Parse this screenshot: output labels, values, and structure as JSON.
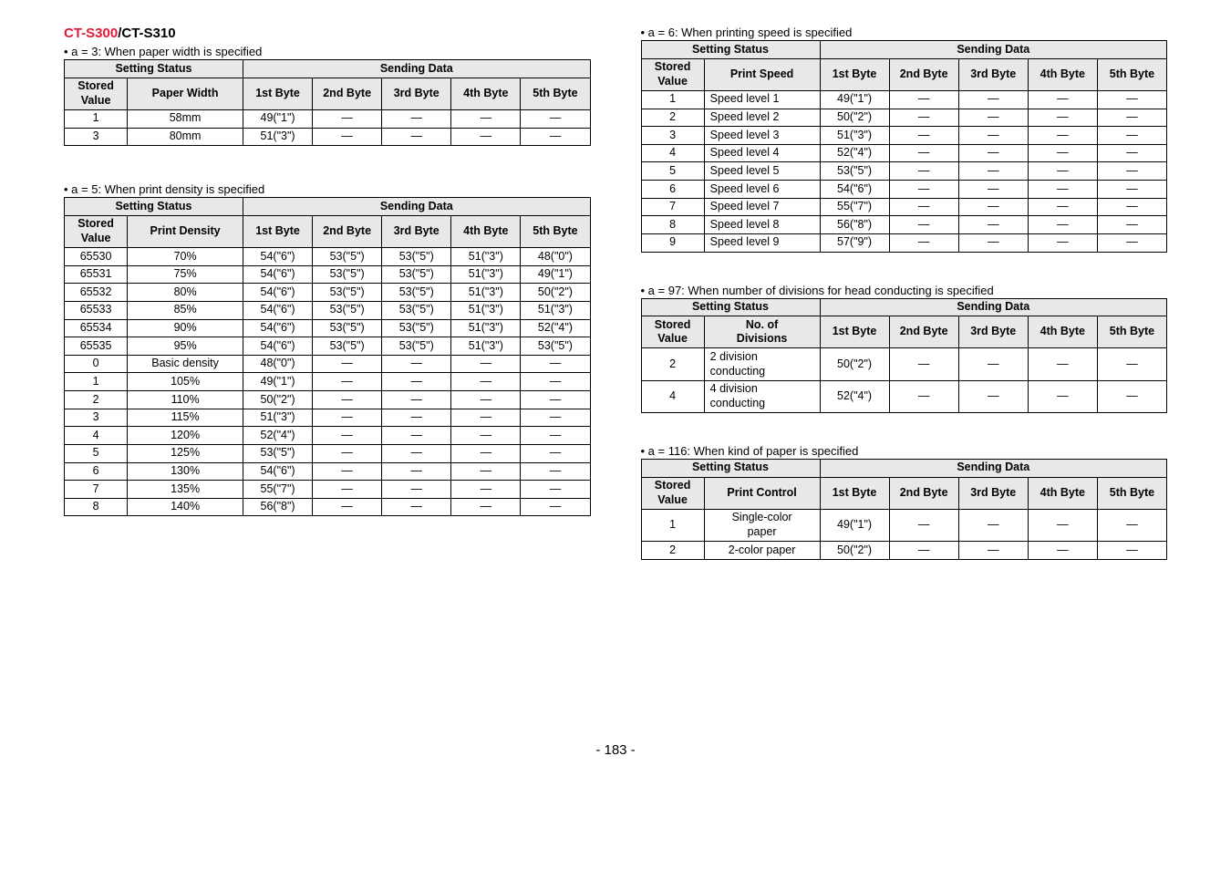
{
  "header": {
    "model_red": "CT-S300",
    "model_sep": "/",
    "model_black": "CT-S310"
  },
  "captions": {
    "a3": "• a = 3: When paper width is specified",
    "a5": "• a = 5: When print density is specified",
    "a6": "• a = 6: When printing speed is specified",
    "a97": "• a = 97: When number of divisions for head conducting is specified",
    "a116": "• a = 116: When kind of paper is specified"
  },
  "headers": {
    "setting_status": "Setting Status",
    "sending_data": "Sending Data",
    "stored_value": "Stored\nValue",
    "b1": "1st Byte",
    "b2": "2nd Byte",
    "b3": "3rd Byte",
    "b4": "4th Byte",
    "b5": "5th Byte"
  },
  "a3": {
    "param": "Paper Width",
    "rows": [
      {
        "sv": "1",
        "p": "58mm",
        "c": [
          "49(\"1\")",
          "—",
          "—",
          "—",
          "—"
        ]
      },
      {
        "sv": "3",
        "p": "80mm",
        "c": [
          "51(\"3\")",
          "—",
          "—",
          "—",
          "—"
        ]
      }
    ]
  },
  "a5": {
    "param": "Print Density",
    "rows": [
      {
        "sv": "65530",
        "p": "70%",
        "c": [
          "54(\"6\")",
          "53(\"5\")",
          "53(\"5\")",
          "51(\"3\")",
          "48(\"0\")"
        ]
      },
      {
        "sv": "65531",
        "p": "75%",
        "c": [
          "54(\"6\")",
          "53(\"5\")",
          "53(\"5\")",
          "51(\"3\")",
          "49(\"1\")"
        ]
      },
      {
        "sv": "65532",
        "p": "80%",
        "c": [
          "54(\"6\")",
          "53(\"5\")",
          "53(\"5\")",
          "51(\"3\")",
          "50(\"2\")"
        ]
      },
      {
        "sv": "65533",
        "p": "85%",
        "c": [
          "54(\"6\")",
          "53(\"5\")",
          "53(\"5\")",
          "51(\"3\")",
          "51(\"3\")"
        ]
      },
      {
        "sv": "65534",
        "p": "90%",
        "c": [
          "54(\"6\")",
          "53(\"5\")",
          "53(\"5\")",
          "51(\"3\")",
          "52(\"4\")"
        ]
      },
      {
        "sv": "65535",
        "p": "95%",
        "c": [
          "54(\"6\")",
          "53(\"5\")",
          "53(\"5\")",
          "51(\"3\")",
          "53(\"5\")"
        ]
      },
      {
        "sv": "0",
        "p": "Basic density",
        "c": [
          "48(\"0\")",
          "—",
          "—",
          "—",
          "—"
        ]
      },
      {
        "sv": "1",
        "p": "105%",
        "c": [
          "49(\"1\")",
          "—",
          "—",
          "—",
          "—"
        ]
      },
      {
        "sv": "2",
        "p": "110%",
        "c": [
          "50(\"2\")",
          "—",
          "—",
          "—",
          "—"
        ]
      },
      {
        "sv": "3",
        "p": "115%",
        "c": [
          "51(\"3\")",
          "—",
          "—",
          "—",
          "—"
        ]
      },
      {
        "sv": "4",
        "p": "120%",
        "c": [
          "52(\"4\")",
          "—",
          "—",
          "—",
          "—"
        ]
      },
      {
        "sv": "5",
        "p": "125%",
        "c": [
          "53(\"5\")",
          "—",
          "—",
          "—",
          "—"
        ]
      },
      {
        "sv": "6",
        "p": "130%",
        "c": [
          "54(\"6\")",
          "—",
          "—",
          "—",
          "—"
        ]
      },
      {
        "sv": "7",
        "p": "135%",
        "c": [
          "55(\"7\")",
          "—",
          "—",
          "—",
          "—"
        ]
      },
      {
        "sv": "8",
        "p": "140%",
        "c": [
          "56(\"8\")",
          "—",
          "—",
          "—",
          "—"
        ]
      }
    ]
  },
  "a6": {
    "param": "Print Speed",
    "rows": [
      {
        "sv": "1",
        "p": "Speed level 1",
        "c": [
          "49(\"1\")",
          "—",
          "—",
          "—",
          "—"
        ]
      },
      {
        "sv": "2",
        "p": "Speed level 2",
        "c": [
          "50(\"2\")",
          "—",
          "—",
          "—",
          "—"
        ]
      },
      {
        "sv": "3",
        "p": "Speed level 3",
        "c": [
          "51(\"3\")",
          "—",
          "—",
          "—",
          "—"
        ]
      },
      {
        "sv": "4",
        "p": "Speed level 4",
        "c": [
          "52(\"4\")",
          "—",
          "—",
          "—",
          "—"
        ]
      },
      {
        "sv": "5",
        "p": "Speed level 5",
        "c": [
          "53(\"5\")",
          "—",
          "—",
          "—",
          "—"
        ]
      },
      {
        "sv": "6",
        "p": "Speed level 6",
        "c": [
          "54(\"6\")",
          "—",
          "—",
          "—",
          "—"
        ]
      },
      {
        "sv": "7",
        "p": "Speed level 7",
        "c": [
          "55(\"7\")",
          "—",
          "—",
          "—",
          "—"
        ]
      },
      {
        "sv": "8",
        "p": "Speed level 8",
        "c": [
          "56(\"8\")",
          "—",
          "—",
          "—",
          "—"
        ]
      },
      {
        "sv": "9",
        "p": "Speed level 9",
        "c": [
          "57(\"9\")",
          "—",
          "—",
          "—",
          "—"
        ]
      }
    ]
  },
  "a97": {
    "param": "No. of\nDivisions",
    "rows": [
      {
        "sv": "2",
        "p": "2 division\nconducting",
        "c": [
          "50(\"2\")",
          "—",
          "—",
          "—",
          "—"
        ]
      },
      {
        "sv": "4",
        "p": "4 division\nconducting",
        "c": [
          "52(\"4\")",
          "—",
          "—",
          "—",
          "—"
        ]
      }
    ]
  },
  "a116": {
    "param": "Print Control",
    "rows": [
      {
        "sv": "1",
        "p": "Single-color\npaper",
        "c": [
          "49(\"1\")",
          "—",
          "—",
          "—",
          "—"
        ]
      },
      {
        "sv": "2",
        "p": "2-color paper",
        "c": [
          "50(\"2\")",
          "—",
          "—",
          "—",
          "—"
        ]
      }
    ]
  },
  "page_num": "- 183 -"
}
